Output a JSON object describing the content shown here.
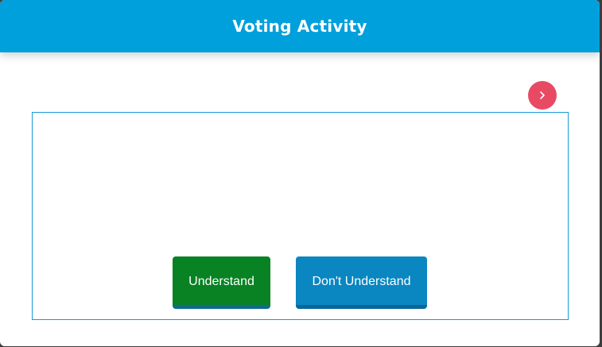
{
  "header": {
    "title": "Voting Activity"
  },
  "navigation": {
    "next_icon": "chevron-right-icon"
  },
  "vote_buttons": {
    "understand_label": "Understand",
    "dont_understand_label": "Don't Understand"
  },
  "colors": {
    "header": "#00a0dc",
    "next_button": "#e84a64",
    "understand": "#088223",
    "dont_understand": "#0a86c1",
    "frame_border": "#1a9bd7"
  }
}
